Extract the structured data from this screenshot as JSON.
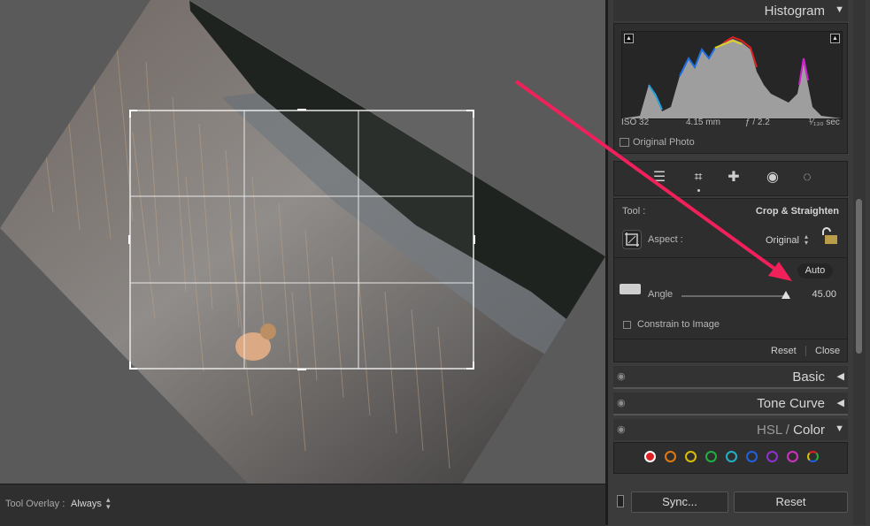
{
  "canvas": {
    "tool_overlay_label": "Tool Overlay :",
    "tool_overlay_value": "Always"
  },
  "histogram": {
    "title": "Histogram",
    "iso": "ISO 32",
    "focal": "4.15 mm",
    "aperture": "ƒ / 2.2",
    "shutter": "¹⁄₁₃₀ sec",
    "original_photo": "Original Photo"
  },
  "tools": {
    "items": [
      "sliders-icon",
      "crop-icon",
      "heal-icon",
      "redeye-icon",
      "mask-icon"
    ]
  },
  "crop": {
    "tool_label": "Tool :",
    "tool_value": "Crop & Straighten",
    "aspect_label": "Aspect :",
    "aspect_value": "Original",
    "auto_label": "Auto",
    "angle_label": "Angle",
    "angle_value": "45.00",
    "angle_fraction": 0.97,
    "constrain_label": "Constrain to Image",
    "reset_label": "Reset",
    "close_label": "Close"
  },
  "panels": {
    "basic": "Basic",
    "tone_curve": "Tone Curve",
    "hsl": "HSL",
    "color": "Color"
  },
  "hsl_colors": [
    "#e02020",
    "#e07a10",
    "#d8c000",
    "#20b040",
    "#20b0c8",
    "#2060e0",
    "#9030d0",
    "#d030c0"
  ],
  "buttons": {
    "sync": "Sync...",
    "reset": "Reset"
  }
}
